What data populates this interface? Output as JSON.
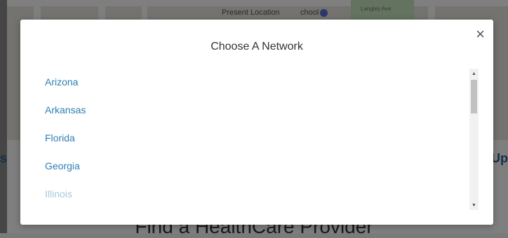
{
  "background": {
    "map_labels": [
      "Present Location",
      "chool",
      "Langley Ave"
    ],
    "page_left_text": "s",
    "page_right_text": "Up",
    "page_bottom_text": "Find a HealthCare Provider"
  },
  "modal": {
    "title": "Choose A Network",
    "close_label": "×",
    "items": [
      {
        "label": "Arizona"
      },
      {
        "label": "Arkansas"
      },
      {
        "label": "Florida"
      },
      {
        "label": "Georgia"
      },
      {
        "label": "Illinois"
      }
    ]
  },
  "scrollbar": {
    "up_arrow": "▲",
    "down_arrow": "▼"
  },
  "colors": {
    "link": "#2f7eb5",
    "overlay": "rgba(0,0,0,0.5)"
  }
}
